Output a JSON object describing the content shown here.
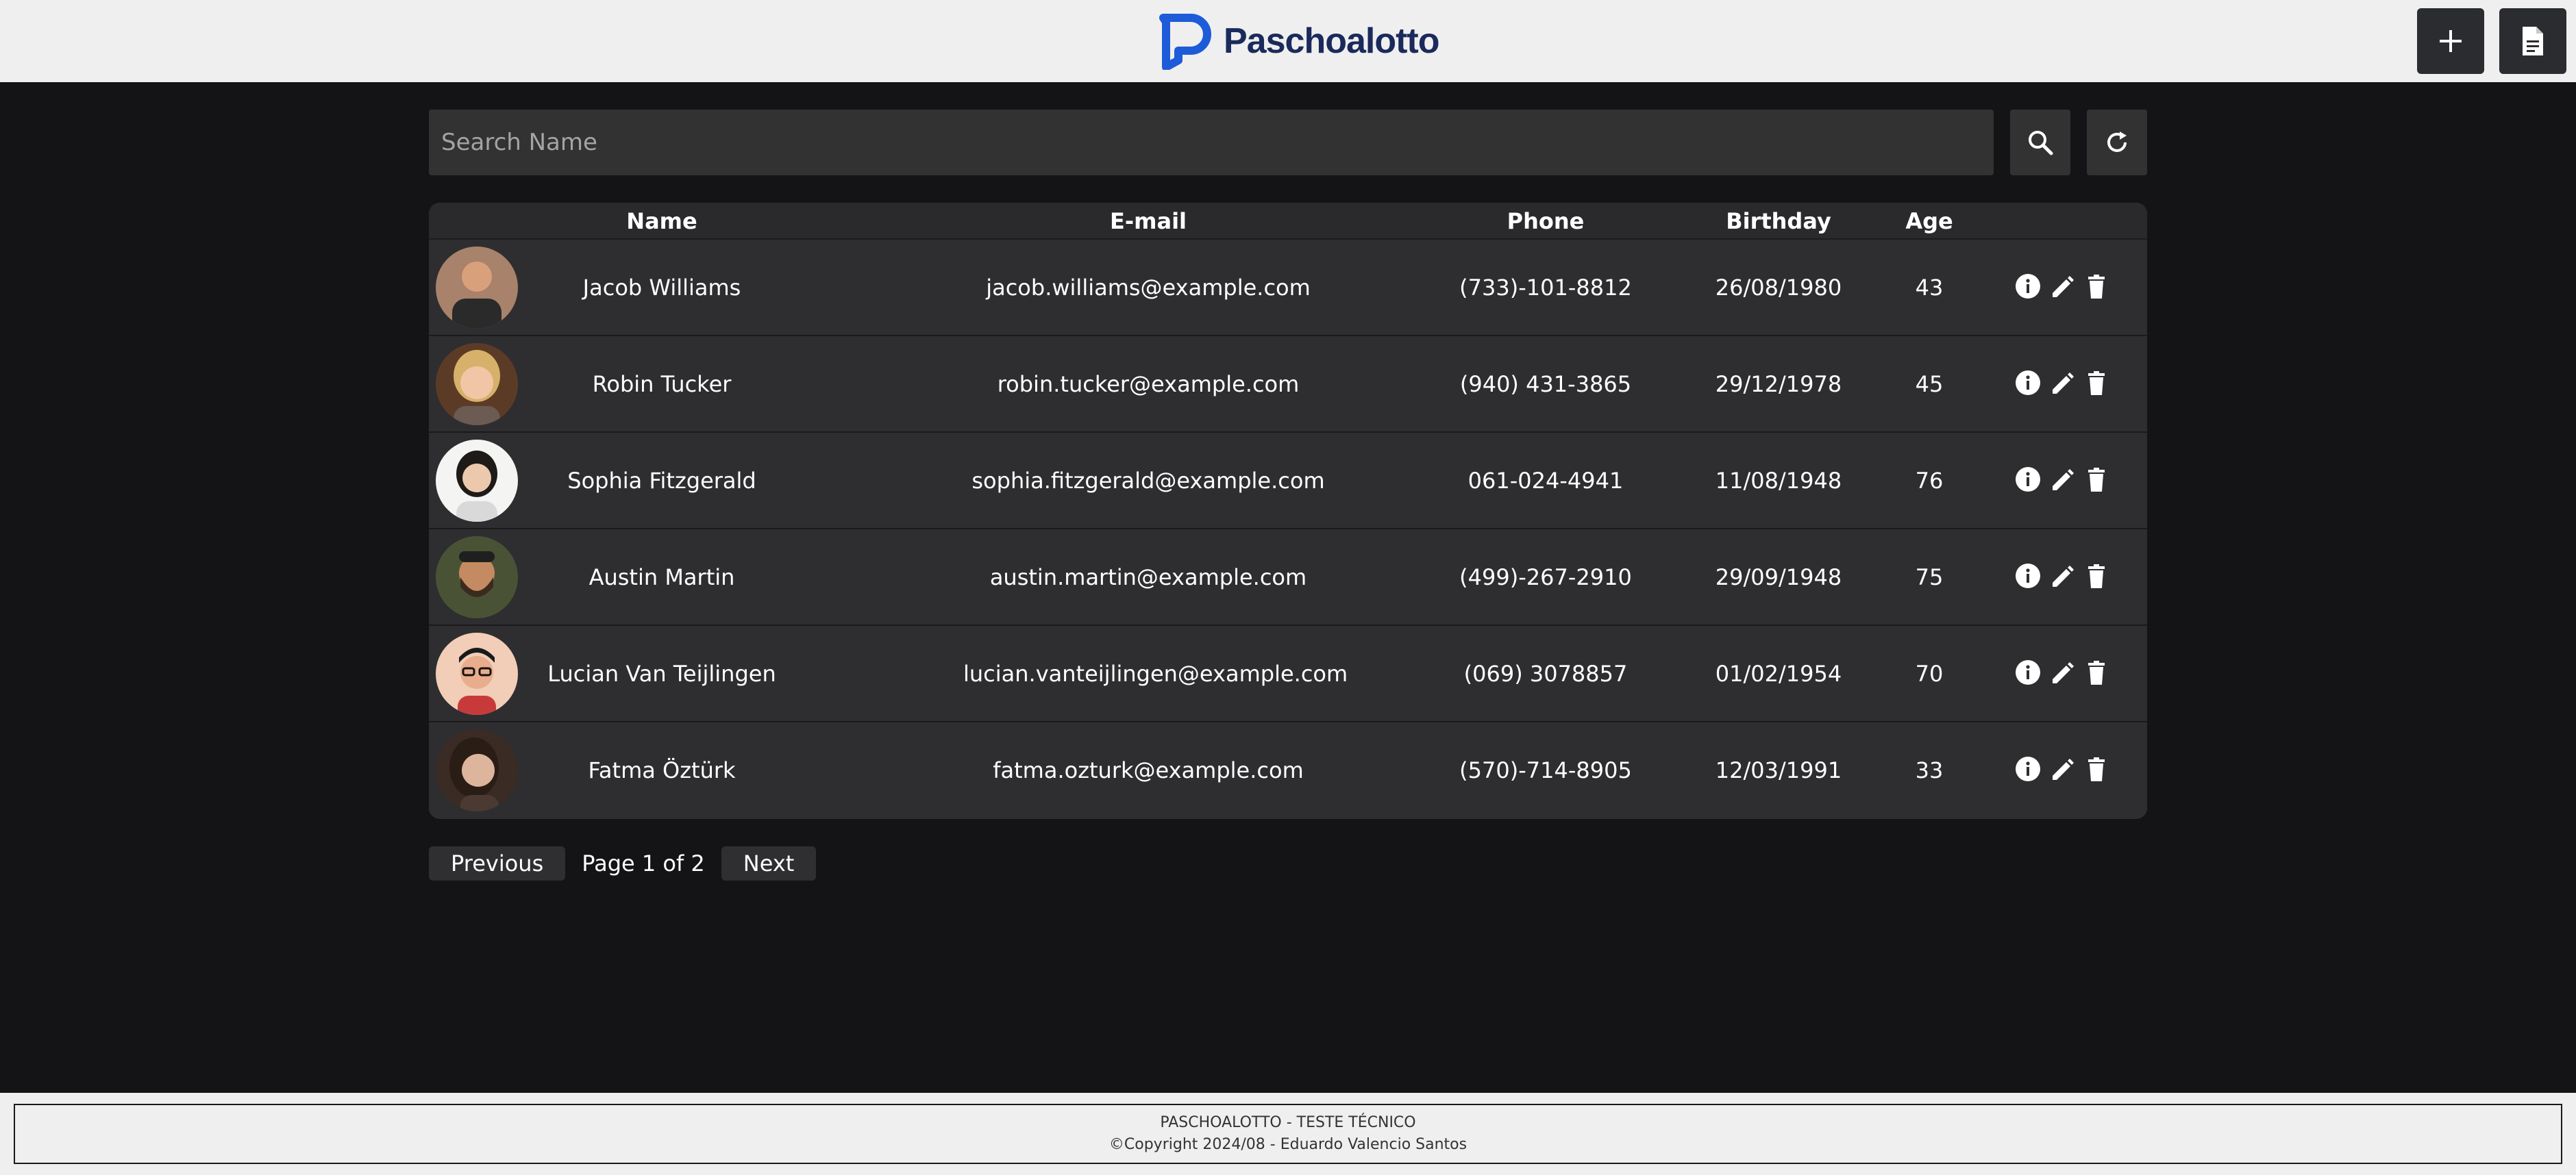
{
  "header": {
    "logo_text": "Paschoalotto",
    "add_button_icon": "plus-icon",
    "report_button_icon": "document-icon"
  },
  "search": {
    "placeholder": "Search Name",
    "value": "",
    "search_icon": "search-icon",
    "refresh_icon": "refresh-icon"
  },
  "table": {
    "columns": [
      "Name",
      "E-mail",
      "Phone",
      "Birthday",
      "Age"
    ],
    "rows": [
      {
        "name": "Jacob Williams",
        "email": "jacob.williams@example.com",
        "phone": "(733)-101-8812",
        "birthday": "26/08/1980",
        "age": "43"
      },
      {
        "name": "Robin Tucker",
        "email": "robin.tucker@example.com",
        "phone": "(940) 431-3865",
        "birthday": "29/12/1978",
        "age": "45"
      },
      {
        "name": "Sophia Fitzgerald",
        "email": "sophia.fitzgerald@example.com",
        "phone": "061-024-4941",
        "birthday": "11/08/1948",
        "age": "76"
      },
      {
        "name": "Austin Martin",
        "email": "austin.martin@example.com",
        "phone": "(499)-267-2910",
        "birthday": "29/09/1948",
        "age": "75"
      },
      {
        "name": "Lucian Van Teijlingen",
        "email": "lucian.vanteijlingen@example.com",
        "phone": "(069) 3078857",
        "birthday": "01/02/1954",
        "age": "70"
      },
      {
        "name": "Fatma Öztürk",
        "email": "fatma.ozturk@example.com",
        "phone": "(570)-714-8905",
        "birthday": "12/03/1991",
        "age": "33"
      }
    ],
    "row_action_icons": [
      "info-icon",
      "edit-icon",
      "delete-icon"
    ]
  },
  "pagination": {
    "previous_label": "Previous",
    "page_text": "Page 1 of 2",
    "next_label": "Next"
  },
  "footer": {
    "line1": "PASCHOALOTTO - TESTE TÉCNICO",
    "line2": "©Copyright 2024/08 - Eduardo Valencio Santos"
  },
  "colors": {
    "background": "#141416",
    "header_bg": "#efefef",
    "logo_blue": "#1e5bd8",
    "panel": "#2e2e30"
  }
}
